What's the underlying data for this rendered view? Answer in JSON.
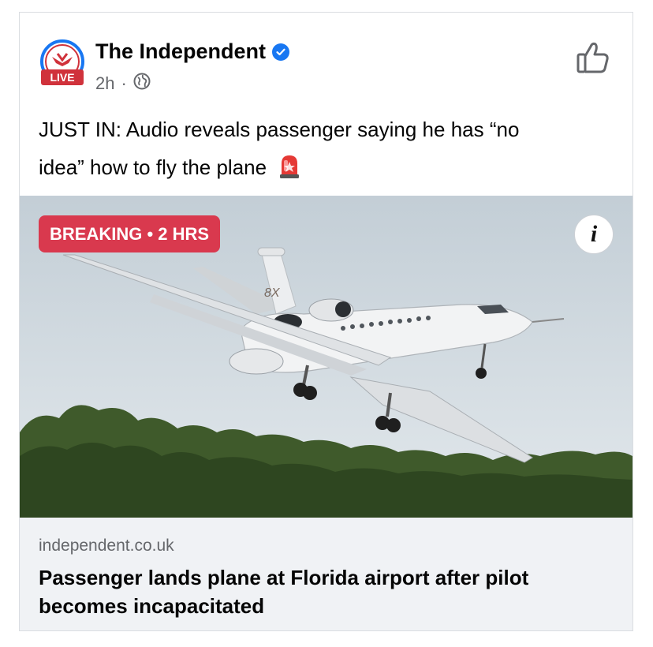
{
  "post": {
    "page_name": "The Independent",
    "avatar_badge": "LIVE",
    "time": "2h",
    "separator": "·",
    "text_line1": "JUST IN: Audio reveals passenger saying he has “no",
    "text_line2": "idea” how to fly the plane",
    "emoji": "🚨"
  },
  "image": {
    "badge": "BREAKING • 2 HRS",
    "tail_text": "8X",
    "info_glyph": "i"
  },
  "link": {
    "domain": "independent.co.uk",
    "title": "Passenger lands plane at Florida airport after pilot becomes incapacitated"
  },
  "colors": {
    "brand_red": "#d0323b",
    "verified_blue": "#1877f2",
    "badge_red": "#d9394e"
  },
  "icons": [
    "avatar-logo",
    "verified-icon",
    "globe-icon",
    "like-icon",
    "info-icon",
    "siren-emoji-icon"
  ]
}
